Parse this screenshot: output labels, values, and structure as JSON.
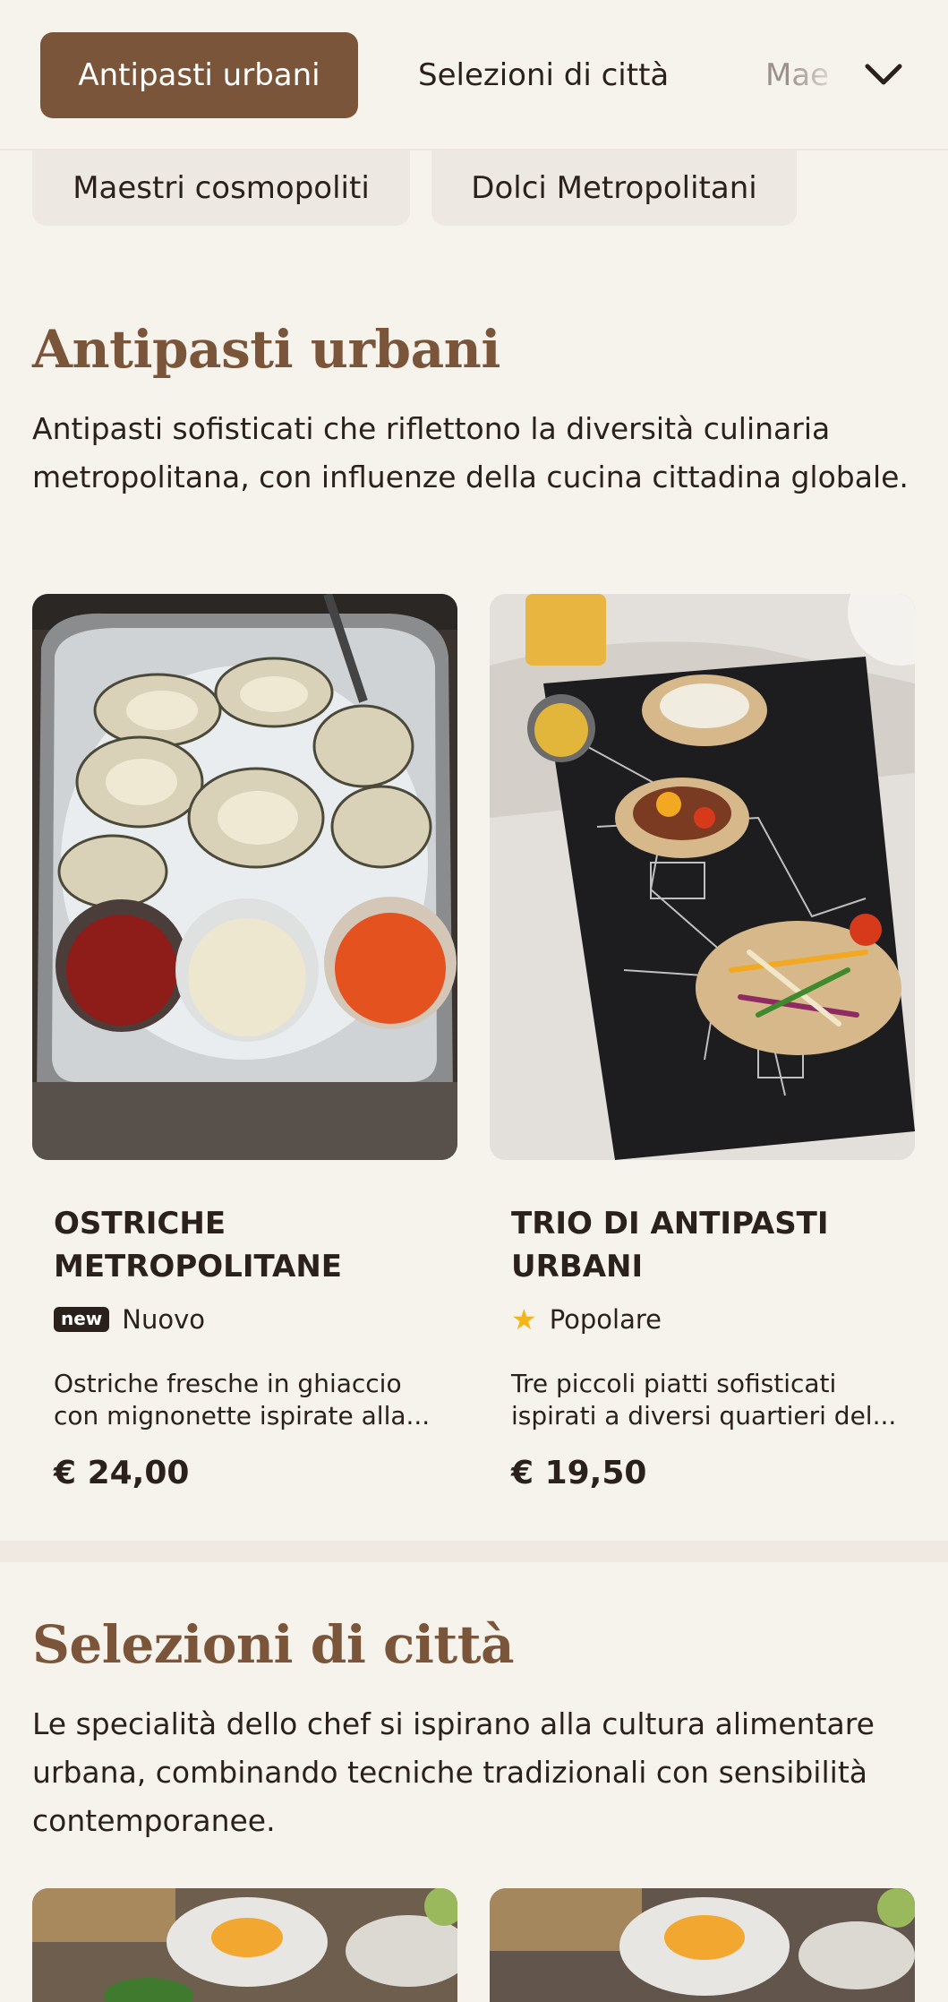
{
  "nav": {
    "tabs": [
      {
        "label": "Antipasti urbani",
        "active": true
      },
      {
        "label": "Selezioni di città",
        "active": false
      },
      {
        "label": "Maestri cosmopoliti",
        "active": false
      }
    ],
    "truncated_tab": "Mae",
    "expand_icon": "chevron-down-icon",
    "dropdown_chips": [
      "Maestri cosmopoliti",
      "Dolci Metropolitani"
    ]
  },
  "colors": {
    "accent": "#7b553a",
    "background": "#f6f2ec",
    "chip": "#ede8e1",
    "star": "#f2b51b"
  },
  "sections": [
    {
      "title": "Antipasti urbani",
      "description": "Antipasti sofisticati che riflettono la diversità culinaria metropolitana, con influenze della cucina cittadina globale.",
      "items": [
        {
          "name": "OSTRICHE METROPOLITANE",
          "badge_icon": "new",
          "badge_label": "Nuovo",
          "description": "Ostriche fresche in ghiaccio con mignonette ispirate alla...",
          "price": "€ 24,00"
        },
        {
          "name": "TRIO DI ANTIPASTI URBANI",
          "badge_icon": "star-icon",
          "badge_label": "Popolare",
          "description": "Tre piccoli piatti sofisticati ispirati a diversi quartieri del...",
          "price": "€ 19,50"
        }
      ]
    },
    {
      "title": "Selezioni di città",
      "description": "Le specialità dello chef si ispirano alla cultura alimentare urbana, combinando tecniche tradizionali con sensibilità contemporanee."
    }
  ]
}
